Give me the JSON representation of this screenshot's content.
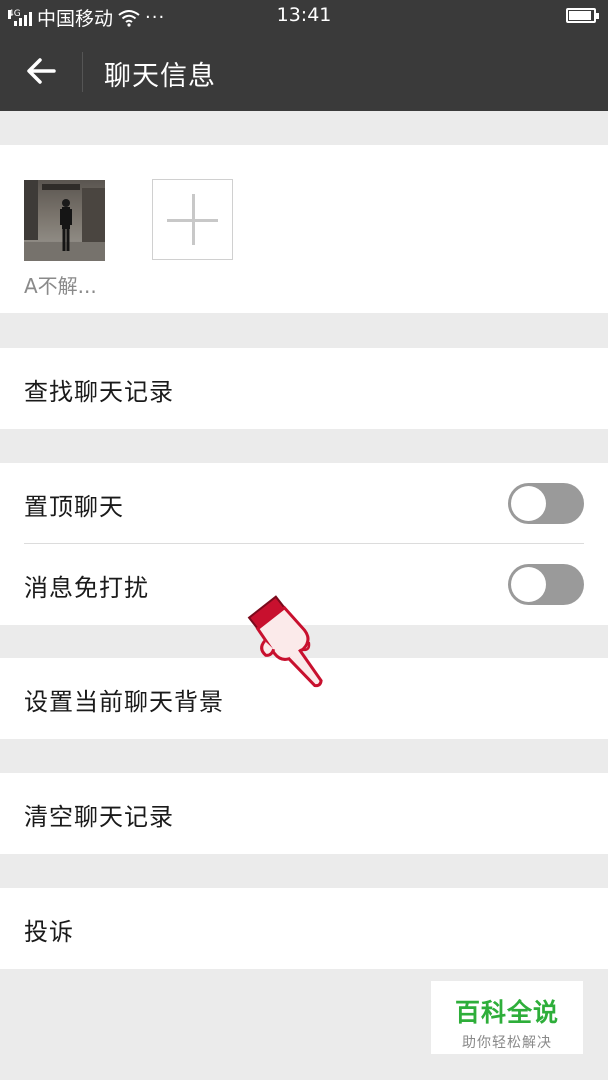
{
  "status_bar": {
    "carrier": "中国移动",
    "network": "4G",
    "more": "···",
    "time": "13:41",
    "battery_level": 0.9
  },
  "header": {
    "back_icon": "arrow-left-icon",
    "title": "聊天信息"
  },
  "members": {
    "items": [
      {
        "name": "A不解..."
      }
    ],
    "add_icon": "plus-icon"
  },
  "rows": {
    "search_history": "查找聊天记录",
    "pin_chat": {
      "label": "置顶聊天",
      "on": false
    },
    "mute": {
      "label": "消息免打扰",
      "on": false
    },
    "set_background": "设置当前聊天背景",
    "clear_history": "清空聊天记录",
    "report": "投诉"
  },
  "watermark": {
    "brand": "百科全说",
    "slogan": "助你轻松解决"
  },
  "colors": {
    "header_bg": "#3a3a3a",
    "page_bg": "#ebebeb",
    "toggle_off": "#9a9a9a",
    "brand_green": "#2eae3a",
    "pointer_red": "#c8102e"
  }
}
